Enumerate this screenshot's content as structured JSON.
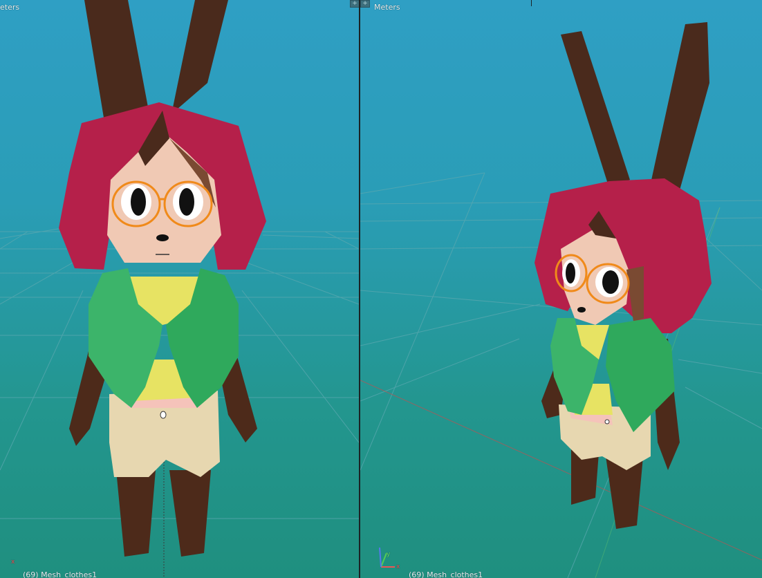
{
  "viewports": {
    "left": {
      "units_label": "eters",
      "object_info": "(69) Mesh_clothes1"
    },
    "right": {
      "units_label": "Meters",
      "object_info": "(69) Mesh_clothes1"
    }
  },
  "axis_gizmo": {
    "x_label": "x",
    "y_label": "y"
  },
  "icons": {
    "split_left": "+",
    "split_right": "+"
  },
  "colors": {
    "ears": "#4a2a1c",
    "hair": "#b5204a",
    "skin": "#f0c9b4",
    "shirt": "#3cb46a",
    "undershirt": "#e7e363",
    "shorts": "#e7d7b0",
    "legs": "#4d2a1a",
    "glasses": "#f08a1a"
  }
}
